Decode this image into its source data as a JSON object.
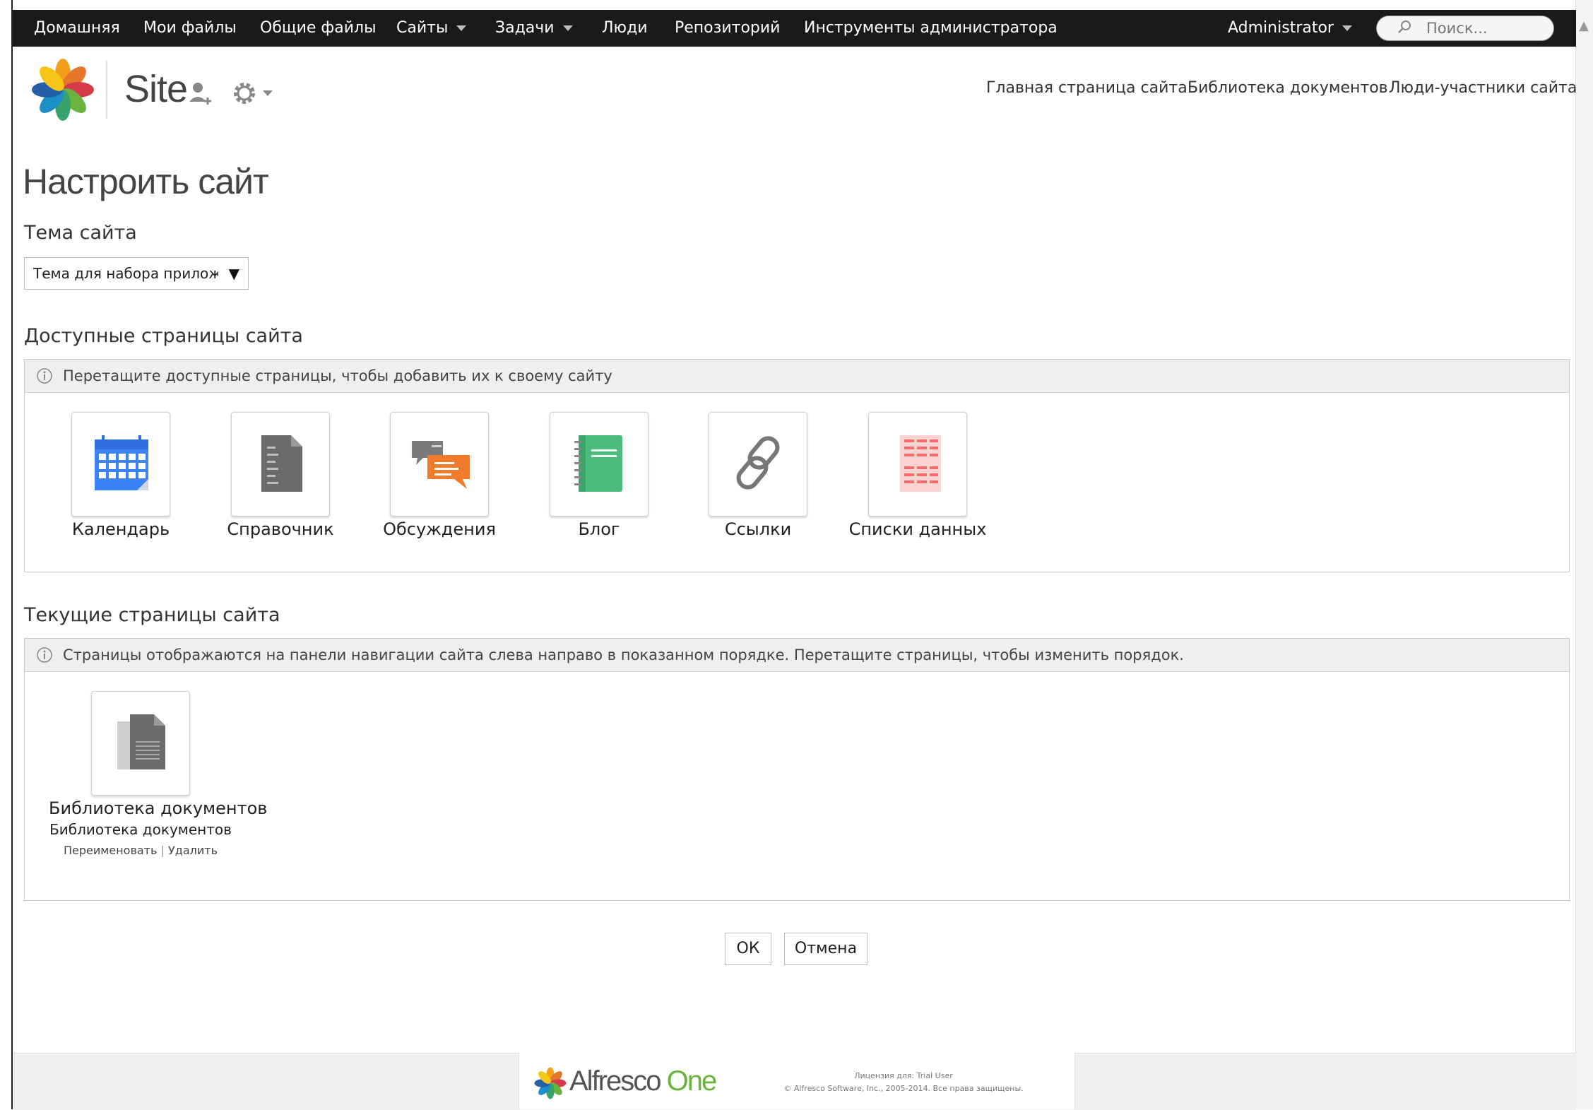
{
  "topnav": {
    "items": [
      {
        "label": "Домашняя"
      },
      {
        "label": "Мои файлы"
      },
      {
        "label": "Общие файлы"
      },
      {
        "label": "Сайты"
      },
      {
        "label": "Задачи"
      },
      {
        "label": "Люди"
      },
      {
        "label": "Репозиторий"
      },
      {
        "label": "Инструменты администратора"
      }
    ],
    "user": "Administrator",
    "search_placeholder": "Поиск..."
  },
  "site_header": {
    "title": "Site",
    "nav": [
      {
        "label": "Главная страница сайта"
      },
      {
        "label": "Библиотека документов"
      },
      {
        "label": "Люди-участники сайта"
      }
    ]
  },
  "page": {
    "title": "Настроить сайт",
    "theme_label": "Тема сайта",
    "theme_value": "Тема для набора прилож",
    "available_title": "Доступные страницы сайта",
    "available_hint": "Перетащите доступные страницы, чтобы добавить их к своему сайту",
    "available_pages": [
      {
        "label": "Календарь"
      },
      {
        "label": "Справочник"
      },
      {
        "label": "Обсуждения"
      },
      {
        "label": "Блог"
      },
      {
        "label": "Ссылки"
      },
      {
        "label": "Списки данных"
      }
    ],
    "current_title": "Текущие страницы сайта",
    "current_hint": "Страницы отображаются на панели навигации сайта слева направо в показанном порядке. Перетащите страницы, чтобы изменить порядок.",
    "current_pages": [
      {
        "label": "Библиотека документов",
        "sublabel": "Библиотека документов",
        "rename": "Переименовать",
        "separator": "|",
        "delete": "Удалить"
      }
    ],
    "ok_label": "ОК",
    "cancel_label": "Отмена"
  },
  "footer": {
    "brand_main": "Alfresco",
    "brand_one": "One",
    "license": "Лицензия для: Trial User",
    "copyright": "© Alfresco Software, Inc., 2005-2014. Все права защищены."
  },
  "colors": {
    "topbar": "#1a1a1a",
    "calendar_blue": "#3b82f6",
    "discussion_orange": "#f07b2a",
    "blog_green": "#4cbb7d",
    "datalist_red": "#f26d6d",
    "brand_green": "#6ab43e"
  }
}
